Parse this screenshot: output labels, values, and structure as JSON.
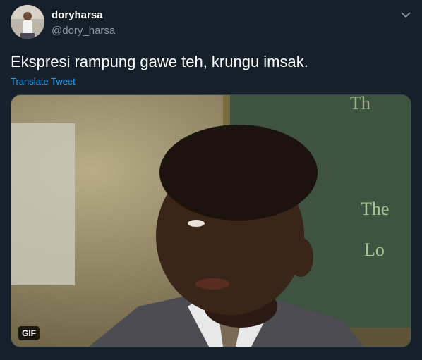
{
  "tweet": {
    "author": {
      "display_name": "doryharsa",
      "handle": "@dory_harsa"
    },
    "text": "Ekspresi rampung gawe teh, krungu imsak.",
    "translate_label": "Translate Tweet",
    "media": {
      "badge": "GIF"
    }
  },
  "icons": {
    "menu": "chevron-down-icon"
  },
  "colors": {
    "background": "#15202b",
    "link": "#1da1f2",
    "secondary_text": "#8899a6"
  }
}
